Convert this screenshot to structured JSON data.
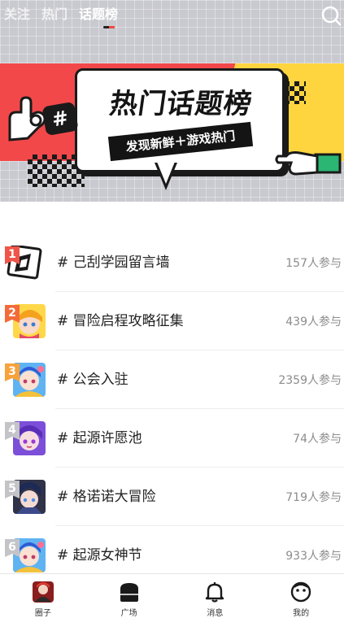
{
  "header": {
    "tabs": [
      {
        "label": "关注",
        "active": false
      },
      {
        "label": "热门",
        "active": false
      },
      {
        "label": "话题榜",
        "active": true
      }
    ]
  },
  "banner": {
    "title": "热门话题榜",
    "subtitle": "发现新鲜＋游戏热门",
    "hash_symbol": "#"
  },
  "topics": [
    {
      "rank": "1",
      "name": "# 己刮学园留言墙",
      "count": "157人参与",
      "rank_color": "#f0554a",
      "thumb": "sticker"
    },
    {
      "rank": "2",
      "name": "# 冒险启程攻略征集",
      "count": "439人参与",
      "rank_color": "#f36b3b",
      "thumb": "girl-yellow"
    },
    {
      "rank": "3",
      "name": "# 公会入驻",
      "count": "2359人参与",
      "rank_color": "#f7a23a",
      "thumb": "girl-blue"
    },
    {
      "rank": "4",
      "name": "# 起源许愿池",
      "count": "74人参与",
      "rank_color": "#c4c4c8",
      "thumb": "girl-purple"
    },
    {
      "rank": "5",
      "name": "# 格诺诺大冒险",
      "count": "719人参与",
      "rank_color": "#c4c4c8",
      "thumb": "girl-dark"
    },
    {
      "rank": "6",
      "name": "# 起源女神节",
      "count": "933人参与",
      "rank_color": "#c4c4c8",
      "thumb": "girl-blue"
    }
  ],
  "bottom_nav": [
    {
      "label": "圈子",
      "icon": "circle-avatar-icon"
    },
    {
      "label": "广场",
      "icon": "square-icon",
      "active": true
    },
    {
      "label": "消息",
      "icon": "bell-icon"
    },
    {
      "label": "我的",
      "icon": "profile-icon"
    }
  ]
}
